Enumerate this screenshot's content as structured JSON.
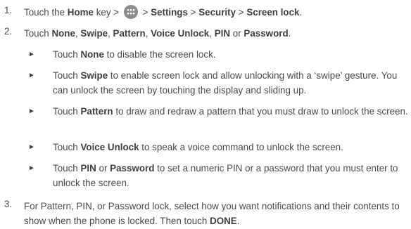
{
  "steps": [
    {
      "number": "1.",
      "parts": [
        {
          "text": "Touch the ",
          "bold": false
        },
        {
          "text": "Home",
          "bold": true
        },
        {
          "text": " key > ",
          "bold": false
        },
        {
          "icon": "all-apps-icon"
        },
        {
          "text": " > ",
          "bold": false
        },
        {
          "text": "Settings",
          "bold": true
        },
        {
          "text": " > ",
          "bold": false
        },
        {
          "text": "Security",
          "bold": true
        },
        {
          "text": " > ",
          "bold": false
        },
        {
          "text": "Screen lock",
          "bold": true
        },
        {
          "text": ".",
          "bold": false
        }
      ]
    },
    {
      "number": "2.",
      "parts": [
        {
          "text": "Touch ",
          "bold": false
        },
        {
          "text": "None",
          "bold": true
        },
        {
          "text": ", ",
          "bold": false
        },
        {
          "text": "Swipe",
          "bold": true
        },
        {
          "text": ", ",
          "bold": false
        },
        {
          "text": "Pattern",
          "bold": true
        },
        {
          "text": ", ",
          "bold": false
        },
        {
          "text": "Voice Unlock",
          "bold": true
        },
        {
          "text": ", ",
          "bold": false
        },
        {
          "text": "PIN",
          "bold": true
        },
        {
          "text": " or ",
          "bold": false
        },
        {
          "text": "Password",
          "bold": true
        },
        {
          "text": ".",
          "bold": false
        }
      ]
    },
    {
      "number": "3.",
      "parts": [
        {
          "text": "For Pattern, PIN, or Password lock, select how you want notifications and their contents to show when the phone is locked. Then touch ",
          "bold": false
        },
        {
          "text": "DONE",
          "bold": true
        },
        {
          "text": ".",
          "bold": false
        }
      ]
    }
  ],
  "bullet_symbol": "►",
  "sub_items": [
    {
      "parts": [
        {
          "text": "Touch ",
          "bold": false
        },
        {
          "text": "None",
          "bold": true
        },
        {
          "text": " to disable the screen lock.",
          "bold": false
        }
      ]
    },
    {
      "parts": [
        {
          "text": "Touch ",
          "bold": false
        },
        {
          "text": "Swipe",
          "bold": true
        },
        {
          "text": " to enable screen lock and allow unlocking with a ‘swipe’ gesture. You can unlock the screen by touching the display and sliding up.",
          "bold": false
        }
      ]
    },
    {
      "parts": [
        {
          "text": "Touch ",
          "bold": false
        },
        {
          "text": "Pattern",
          "bold": true
        },
        {
          "text": " to draw and redraw a pattern that you must draw to unlock the screen.",
          "bold": false
        }
      ]
    },
    {
      "parts": [
        {
          "text": "Touch ",
          "bold": false
        },
        {
          "text": "Voice Unlock",
          "bold": true
        },
        {
          "text": " to speak a voice command to unlock the screen.",
          "bold": false
        }
      ]
    },
    {
      "parts": [
        {
          "text": "Touch ",
          "bold": false
        },
        {
          "text": "PIN",
          "bold": true
        },
        {
          "text": " or ",
          "bold": false
        },
        {
          "text": "Password",
          "bold": true
        },
        {
          "text": " to set a numeric PIN or a password that you must enter to unlock the screen.",
          "bold": false
        }
      ]
    }
  ]
}
